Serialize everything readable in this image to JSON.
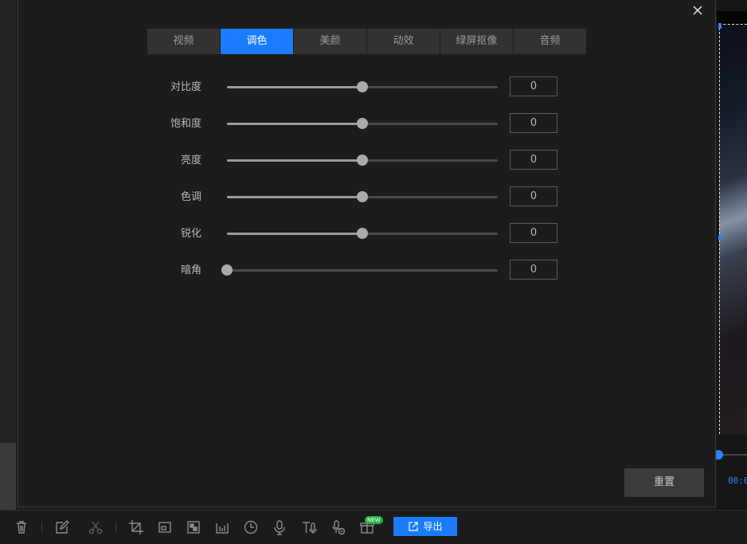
{
  "tabs": [
    {
      "label": "视频",
      "active": false
    },
    {
      "label": "调色",
      "active": true
    },
    {
      "label": "美颜",
      "active": false
    },
    {
      "label": "动效",
      "active": false
    },
    {
      "label": "绿屏抠像",
      "active": false
    },
    {
      "label": "音频",
      "active": false
    }
  ],
  "adjustments": [
    {
      "label": "对比度",
      "value": "0",
      "slider_fraction": 0.5
    },
    {
      "label": "饱和度",
      "value": "0",
      "slider_fraction": 0.5
    },
    {
      "label": "亮度",
      "value": "0",
      "slider_fraction": 0.5
    },
    {
      "label": "色调",
      "value": "0",
      "slider_fraction": 0.5
    },
    {
      "label": "锐化",
      "value": "0",
      "slider_fraction": 0.5
    },
    {
      "label": "暗角",
      "value": "0",
      "slider_fraction": 0.0
    }
  ],
  "reset_label": "重置",
  "close_icon": "close-icon",
  "preview": {
    "time": "00:0"
  },
  "toolbar": {
    "icons": [
      "trash-icon",
      "edit-icon",
      "scissors-icon",
      "crop-icon",
      "resize-icon",
      "mosaic-icon",
      "audio-wave-icon",
      "clock-icon",
      "microphone-icon",
      "text-to-speech-icon",
      "voice-change-icon",
      "gift-icon"
    ],
    "new_badge": "NEW",
    "export_label": "导出"
  },
  "colors": {
    "accent": "#1a7cff",
    "background": "#1c1c1c",
    "tab_inactive": "#323232",
    "badge_green": "#27b24a"
  }
}
